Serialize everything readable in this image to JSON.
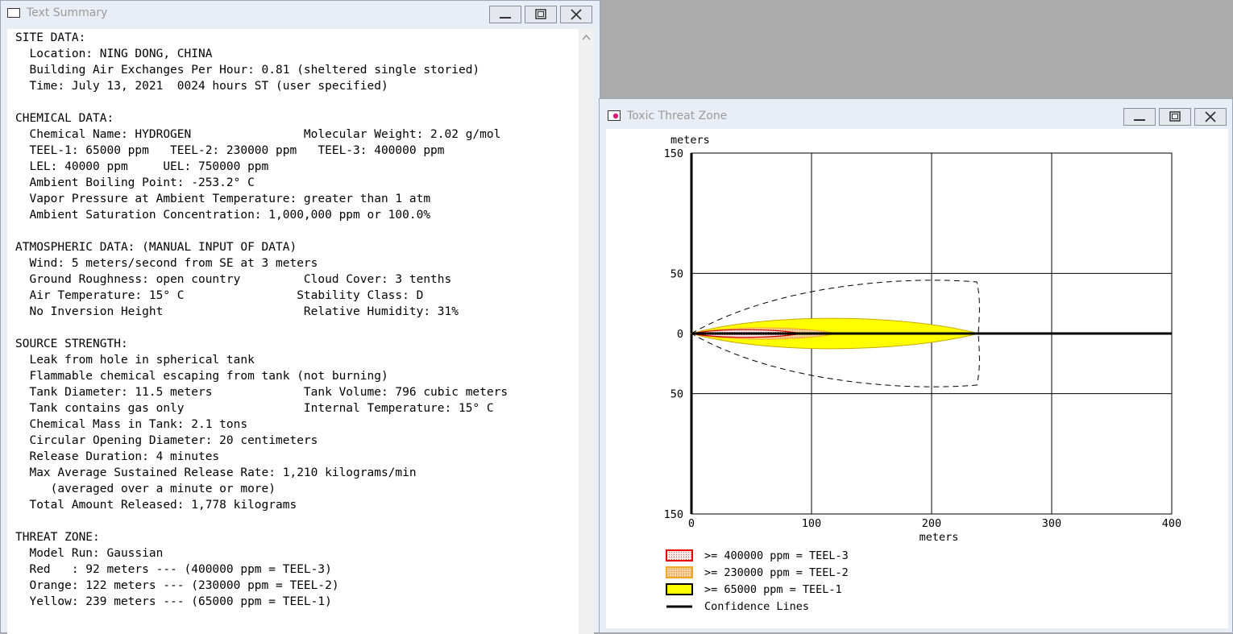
{
  "summary_window": {
    "title": "Text Summary",
    "icon": "window-icon",
    "controls": {
      "minimize": "minimize-icon",
      "maximize": "maximize-icon",
      "close": "close-icon"
    },
    "lines": [
      "SITE DATA:",
      "  Location: NING DONG, CHINA",
      "  Building Air Exchanges Per Hour: 0.81 (sheltered single storied)",
      "  Time: July 13, 2021  0024 hours ST (user specified)",
      "",
      "CHEMICAL DATA:",
      "  Chemical Name: HYDROGEN                Molecular Weight: 2.02 g/mol",
      "  TEEL-1: 65000 ppm   TEEL-2: 230000 ppm   TEEL-3: 400000 ppm",
      "  LEL: 40000 ppm     UEL: 750000 ppm",
      "  Ambient Boiling Point: -253.2° C",
      "  Vapor Pressure at Ambient Temperature: greater than 1 atm",
      "  Ambient Saturation Concentration: 1,000,000 ppm or 100.0%",
      "",
      "ATMOSPHERIC DATA: (MANUAL INPUT OF DATA)",
      "  Wind: 5 meters/second from SE at 3 meters",
      "  Ground Roughness: open country         Cloud Cover: 3 tenths",
      "  Air Temperature: 15° C                Stability Class: D",
      "  No Inversion Height                    Relative Humidity: 31%",
      "",
      "SOURCE STRENGTH:",
      "  Leak from hole in spherical tank",
      "  Flammable chemical escaping from tank (not burning)",
      "  Tank Diameter: 11.5 meters             Tank Volume: 796 cubic meters",
      "  Tank contains gas only                 Internal Temperature: 15° C",
      "  Chemical Mass in Tank: 2.1 tons",
      "  Circular Opening Diameter: 20 centimeters",
      "  Release Duration: 4 minutes",
      "  Max Average Sustained Release Rate: 1,210 kilograms/min",
      "     (averaged over a minute or more)",
      "  Total Amount Released: 1,778 kilograms",
      "",
      "THREAT ZONE:",
      "  Model Run: Gaussian",
      "  Red   : 92 meters --- (400000 ppm = TEEL-3)",
      "  Orange: 122 meters --- (230000 ppm = TEEL-2)",
      "  Yellow: 239 meters --- (65000 ppm = TEEL-1)"
    ]
  },
  "threat_window": {
    "title": "Toxic Threat Zone",
    "icon": "threat-zone-icon",
    "controls": {
      "minimize": "minimize-icon",
      "maximize": "maximize-icon",
      "close": "close-icon"
    }
  },
  "chart_data": {
    "type": "area",
    "title": "",
    "xlabel": "meters",
    "ylabel": "meters",
    "xlim": [
      0,
      400
    ],
    "ylim": [
      -150,
      150
    ],
    "x_ticks": [
      0,
      100,
      200,
      300,
      400
    ],
    "y_ticks": [
      150,
      50,
      0,
      -50,
      -150
    ],
    "y_tick_labels": [
      "150",
      "50",
      "0",
      "50",
      "150"
    ],
    "grid": true,
    "legend_placement": "bottom-left",
    "series": [
      {
        "name": ">= 65000 ppm = TEEL-1",
        "color": "#ffff00",
        "edge": "#c9a800",
        "max_downwind": 239,
        "max_halfwidth": 16
      },
      {
        "name": ">= 230000 ppm = TEEL-2",
        "color": "#f5c989",
        "edge": "#f5a623",
        "max_downwind": 122,
        "max_halfwidth": 6
      },
      {
        "name": ">= 400000 ppm = TEEL-3",
        "color": "#fde7e7",
        "edge": "#cc0000",
        "max_downwind": 92,
        "max_halfwidth": 4
      },
      {
        "name": "Confidence Lines",
        "color": "#000000",
        "max_downwind": 239,
        "max_halfwidth": 42
      }
    ],
    "legend": [
      {
        "label": ">= 400000 ppm = TEEL-3",
        "fill": "#fde7e7",
        "edge": "#ee0000"
      },
      {
        "label": ">= 230000 ppm = TEEL-2",
        "fill": "#f5c989",
        "edge": "#f5a623"
      },
      {
        "label": ">= 65000 ppm = TEEL-1",
        "fill": "#ffff00",
        "edge": "#000000"
      },
      {
        "label": "Confidence Lines",
        "fill": "",
        "edge": "#000000"
      }
    ]
  }
}
